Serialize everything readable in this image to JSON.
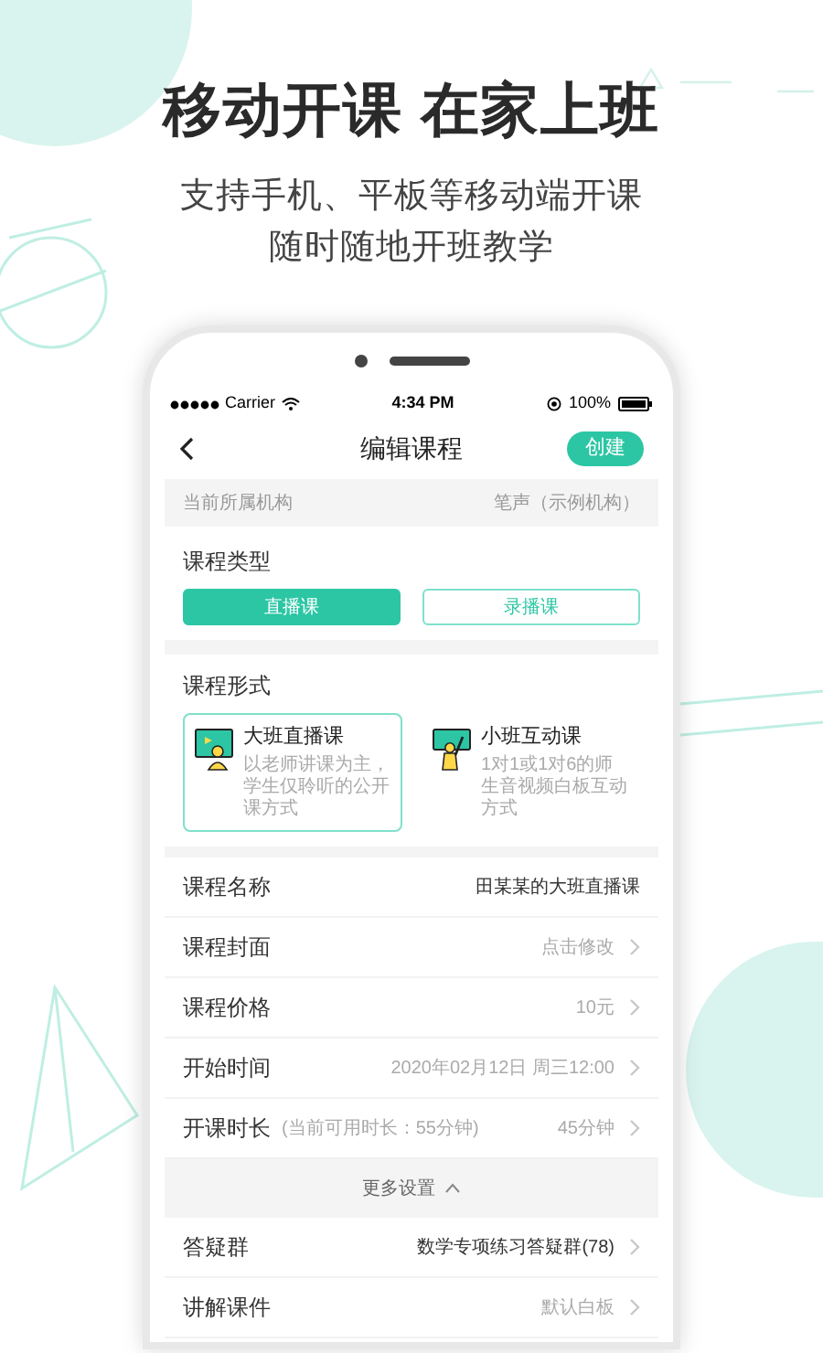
{
  "headline": "移动开课 在家上班",
  "subtitle_lines": [
    "支持手机、平板等移动端开课",
    "随时随地开班教学"
  ],
  "status_bar": {
    "carrier": "Carrier",
    "time": "4:34 PM",
    "battery": "100%"
  },
  "nav": {
    "title": "编辑课程",
    "action": "创建"
  },
  "institution": {
    "label": "当前所属机构",
    "value": "笔声（示例机构）"
  },
  "course_type": {
    "label": "课程类型",
    "options": [
      {
        "label": "直播课",
        "selected": true
      },
      {
        "label": "录播课",
        "selected": false
      }
    ]
  },
  "course_format": {
    "label": "课程形式",
    "options": [
      {
        "title": "大班直播课",
        "description": "以老师讲课为主，学生仅聆听的公开课方式",
        "selected": true
      },
      {
        "title": "小班互动课",
        "description": "1对1或1对6的师生音视频白板互动方式",
        "selected": false
      }
    ]
  },
  "rows": [
    {
      "label": "课程名称",
      "value": "田某某的大班直播课",
      "muted": false,
      "chevron": false
    },
    {
      "label": "课程封面",
      "value": "点击修改",
      "muted": true,
      "chevron": true
    },
    {
      "label": "课程价格",
      "value": "10元",
      "muted": true,
      "chevron": true
    },
    {
      "label": "开始时间",
      "value": "2020年02月12日 周三12:00",
      "muted": true,
      "chevron": true
    },
    {
      "label": "开课时长",
      "note": "(当前可用时长：55分钟)",
      "value": "45分钟",
      "muted": true,
      "chevron": true
    }
  ],
  "more_settings": {
    "label": "更多设置",
    "expanded": true
  },
  "extra_rows": [
    {
      "label": "答疑群",
      "value": "数学专项练习答疑群(78)",
      "muted": false,
      "chevron": true
    },
    {
      "label": "讲解课件",
      "value": "默认白板",
      "muted": true,
      "chevron": true
    }
  ]
}
